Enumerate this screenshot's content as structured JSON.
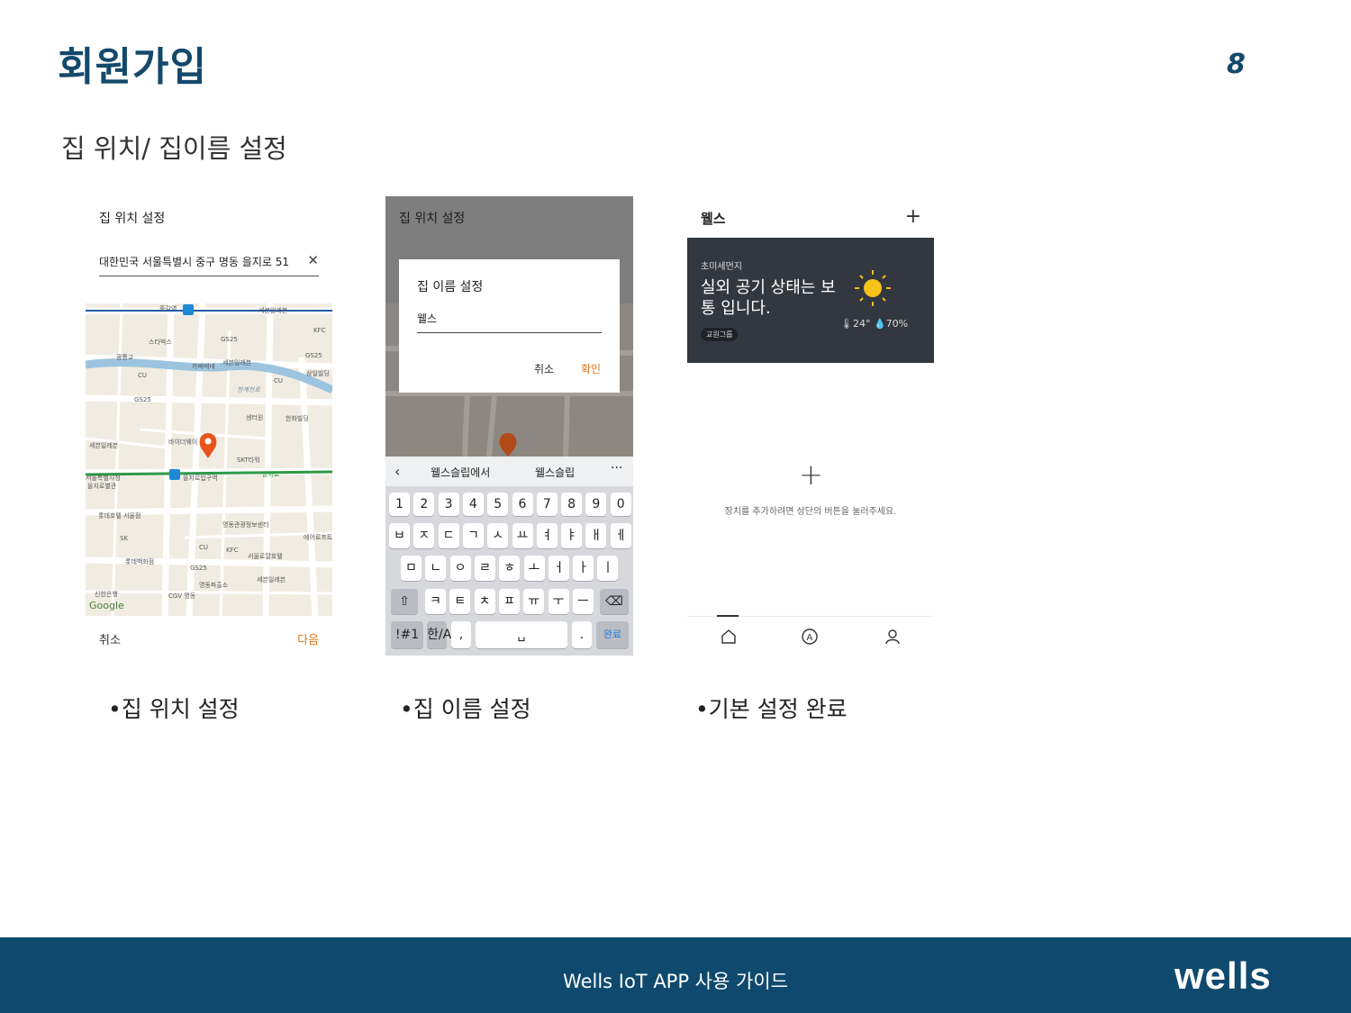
{
  "page": {
    "title": "회원가입",
    "page_number": "8",
    "subtitle": "집 위치/ 집이름 설정",
    "captions": [
      "•집 위치 설정",
      "•집 이름 설정",
      "•기본 설정 완료"
    ],
    "footer_text": "Wells IoT APP 사용 가이드",
    "logo_text": "wells",
    "colors": {
      "brand": "#0f4a6e",
      "accent": "#e0761d"
    }
  },
  "screen1": {
    "header": "집 위치 설정",
    "address": "대한민국 서울특별시 중구 명동 을지로 51",
    "clear_icon": "close-icon",
    "map_labels": [
      "종각역",
      "세븐일레븐",
      "스타벅스",
      "GS25",
      "KFC",
      "광통교",
      "카페베네",
      "세븐일레븐",
      "GS25",
      "CU",
      "청계천로",
      "CU",
      "삼일빌딩",
      "GS25",
      "센터원",
      "한화빌딩",
      "바이더웨이",
      "세븐일레븐",
      "SKT타워",
      "서울특별시청 을지로별관",
      "을지로입구역",
      "을지로",
      "롯데호텔 서울점",
      "명동관광정보센터",
      "SK",
      "CU",
      "KFC",
      "에어로프트",
      "롯데백화점",
      "서울로얄호텔",
      "GS25",
      "세븐일레븐",
      "명동파출소",
      "신한은행",
      "CGV 명동",
      "Google"
    ],
    "cancel": "취소",
    "next": "다음"
  },
  "screen2": {
    "header": "집 위치 설정",
    "dialog": {
      "title": "집 이름 설정",
      "value": "웰스",
      "cancel": "취소",
      "ok": "확인"
    },
    "suggestions": [
      "웰스슬립에서",
      "웰스슬립"
    ],
    "keyboard": {
      "row1": [
        "1",
        "2",
        "3",
        "4",
        "5",
        "6",
        "7",
        "8",
        "9",
        "0"
      ],
      "row2": [
        "ㅂ",
        "ㅈ",
        "ㄷ",
        "ㄱ",
        "ㅅ",
        "ㅛ",
        "ㅕ",
        "ㅑ",
        "ㅐ",
        "ㅔ"
      ],
      "row3": [
        "ㅁ",
        "ㄴ",
        "ㅇ",
        "ㄹ",
        "ㅎ",
        "ㅗ",
        "ㅓ",
        "ㅏ",
        "ㅣ"
      ],
      "row4": [
        "ㅋ",
        "ㅌ",
        "ㅊ",
        "ㅍ",
        "ㅠ",
        "ㅜ",
        "ㅡ"
      ],
      "shift": "⇧",
      "backspace": "⌫",
      "sym": "!#1",
      "lang": "한/A",
      "comma": ",",
      "space": "␣",
      "period": ".",
      "done": "완료"
    }
  },
  "screen3": {
    "header": "웰스",
    "card": {
      "label": "초미세먼지",
      "message": "실외 공기 상태는 보통 입니다.",
      "tag": "교원그룹",
      "weather": "🌡24° 💧70%"
    },
    "empty_message": "장치를 추가하려면 상단의 버튼을 눌러주세요."
  }
}
